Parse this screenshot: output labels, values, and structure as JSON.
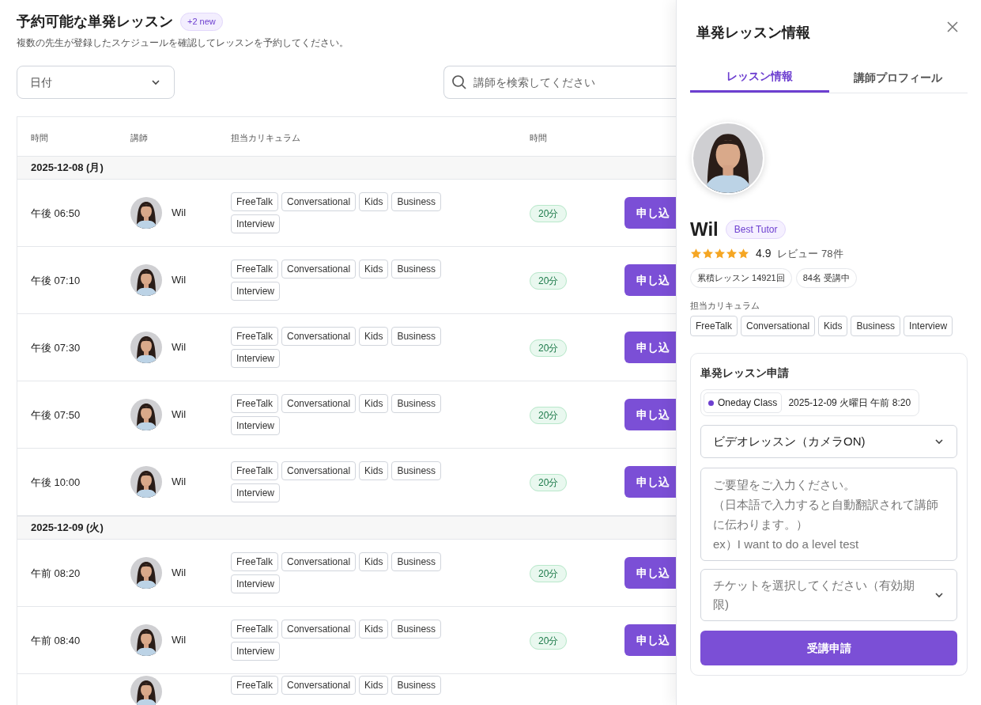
{
  "header": {
    "title": "予約可能な単発レッスン",
    "badge": "+2 new",
    "subtitle": "複数の先生が登録したスケジュールを確認してレッスンを予約してください。"
  },
  "filters": {
    "date_select": {
      "value": "日付"
    },
    "search": {
      "placeholder": "講師を検索してください"
    }
  },
  "table": {
    "columns": [
      "時間",
      "講師",
      "担当カリキュラム",
      "時間"
    ],
    "groups": [
      {
        "date": "2025-12-08 (月)",
        "rows": [
          {
            "time": "午後 06:50",
            "tutor": "Wil",
            "tags": [
              "FreeTalk",
              "Conversational",
              "Kids",
              "Business",
              "Interview"
            ],
            "duration": "20分",
            "action": "申し込"
          },
          {
            "time": "午後 07:10",
            "tutor": "Wil",
            "tags": [
              "FreeTalk",
              "Conversational",
              "Kids",
              "Business",
              "Interview"
            ],
            "duration": "20分",
            "action": "申し込"
          },
          {
            "time": "午後 07:30",
            "tutor": "Wil",
            "tags": [
              "FreeTalk",
              "Conversational",
              "Kids",
              "Business",
              "Interview"
            ],
            "duration": "20分",
            "action": "申し込"
          },
          {
            "time": "午後 07:50",
            "tutor": "Wil",
            "tags": [
              "FreeTalk",
              "Conversational",
              "Kids",
              "Business",
              "Interview"
            ],
            "duration": "20分",
            "action": "申し込"
          },
          {
            "time": "午後 10:00",
            "tutor": "Wil",
            "tags": [
              "FreeTalk",
              "Conversational",
              "Kids",
              "Business",
              "Interview"
            ],
            "duration": "20分",
            "action": "申し込"
          }
        ]
      },
      {
        "date": "2025-12-09 (火)",
        "rows": [
          {
            "time": "午前 08:20",
            "tutor": "Wil",
            "tags": [
              "FreeTalk",
              "Conversational",
              "Kids",
              "Business",
              "Interview"
            ],
            "duration": "20分",
            "action": "申し込"
          },
          {
            "time": "午前 08:40",
            "tutor": "Wil",
            "tags": [
              "FreeTalk",
              "Conversational",
              "Kids",
              "Business",
              "Interview"
            ],
            "duration": "20分",
            "action": "申し込"
          },
          {
            "tags": [
              "FreeTalk",
              "Conversational",
              "Kids",
              "Business"
            ]
          }
        ]
      }
    ]
  },
  "panel": {
    "title": "単発レッスン情報",
    "tabs": [
      {
        "label": "レッスン情報",
        "selected": true
      },
      {
        "label": "講師プロフィール",
        "selected": false
      }
    ],
    "tutor": {
      "name": "Wil",
      "badge": "Best Tutor",
      "stars": 5,
      "rating": "4.9",
      "reviews": "レビュー 78件",
      "stats": [
        "累積レッスン 14921回",
        "84名 受講中"
      ],
      "curriculum_label": "担当カリキュラム",
      "tags": [
        "FreeTalk",
        "Conversational",
        "Kids",
        "Business",
        "Interview"
      ]
    },
    "request": {
      "title": "単発レッスン申請",
      "class_chip": {
        "label": "Oneday Class",
        "color": "#6d3fd0"
      },
      "datetime": "2025-12-09 火曜日 午前 8:20",
      "lesson_type": {
        "value": "ビデオレッスン（カメラON)"
      },
      "message": {
        "placeholder": [
          "ご要望をご入力ください。",
          "（日本語で入力すると自動翻訳されて講師に伝わります。）",
          "ex）I want to do a level test"
        ]
      },
      "ticket": {
        "placeholder": "チケットを選択してください（有効期限)"
      },
      "submit": "受講申請"
    }
  }
}
